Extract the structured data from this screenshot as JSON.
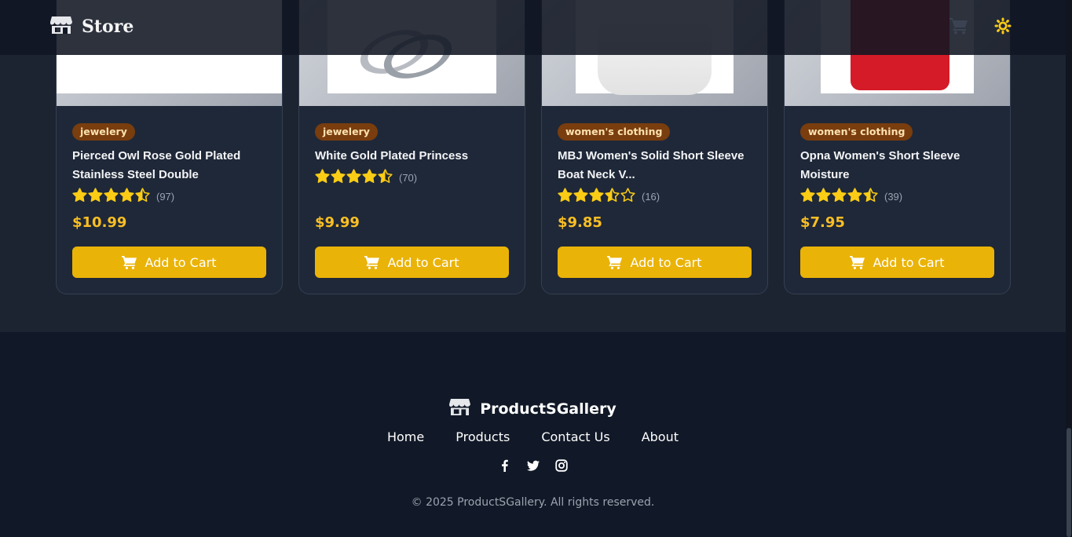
{
  "header": {
    "brand": "Store",
    "brand_icon": "store-icon",
    "cart_icon": "cart-icon",
    "theme_icon": "sun-icon"
  },
  "products": [
    {
      "category": "jewelery",
      "title": "Pierced Owl Rose Gold Plated Stainless Steel Double",
      "rating": 4.5,
      "rating_count": "(97)",
      "price": "$10.99",
      "button_label": "Add to Cart"
    },
    {
      "category": "jewelery",
      "title": "White Gold Plated Princess",
      "rating": 4.5,
      "rating_count": "(70)",
      "price": "$9.99",
      "button_label": "Add to Cart"
    },
    {
      "category": "women's clothing",
      "title": "MBJ Women's Solid Short Sleeve Boat Neck V...",
      "rating": 3.5,
      "rating_count": "(16)",
      "price": "$9.85",
      "button_label": "Add to Cart"
    },
    {
      "category": "women's clothing",
      "title": "Opna Women's Short Sleeve Moisture",
      "rating": 4.5,
      "rating_count": "(39)",
      "price": "$7.95",
      "button_label": "Add to Cart"
    }
  ],
  "footer": {
    "brand": "ProductSGallery",
    "nav": [
      "Home",
      "Products",
      "Contact Us",
      "About"
    ],
    "social_icons": [
      "facebook-icon",
      "twitter-icon",
      "instagram-icon"
    ],
    "copyright": "© 2025 ProductSGallery. All rights reserved."
  },
  "colors": {
    "accent": "#eab308",
    "price": "#fbbf24",
    "badge_bg": "#7a3d0e",
    "footer_bg": "#111827"
  }
}
